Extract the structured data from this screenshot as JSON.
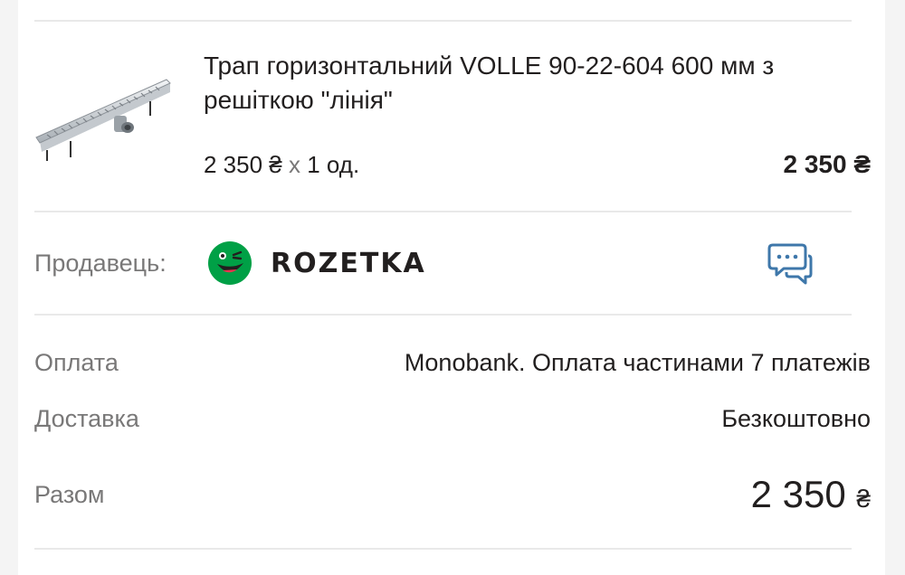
{
  "product": {
    "title": "Трап горизонтальний VOLLE 90-22-604 600 мм з решіткою \"лінія\"",
    "image_icon": "floor-drain-product-image",
    "unit_price": "2 350 ₴",
    "multiplier": "x",
    "quantity": "1 од.",
    "line_total": "2 350 ₴"
  },
  "seller": {
    "label": "Продавець:",
    "logo_icon": "rozetka-smile-logo",
    "name": "ROZETKA",
    "chat_icon": "chat-bubbles-icon",
    "brand_color": "#00a046",
    "chat_color": "#3e77aa"
  },
  "summary": {
    "payment_label": "Оплата",
    "payment_value": "Monobank. Оплата частинами 7 платежів",
    "delivery_label": "Доставка",
    "delivery_value": "Безкоштовно",
    "total_label": "Разом",
    "total_amount": "2 350",
    "total_currency": "₴"
  }
}
